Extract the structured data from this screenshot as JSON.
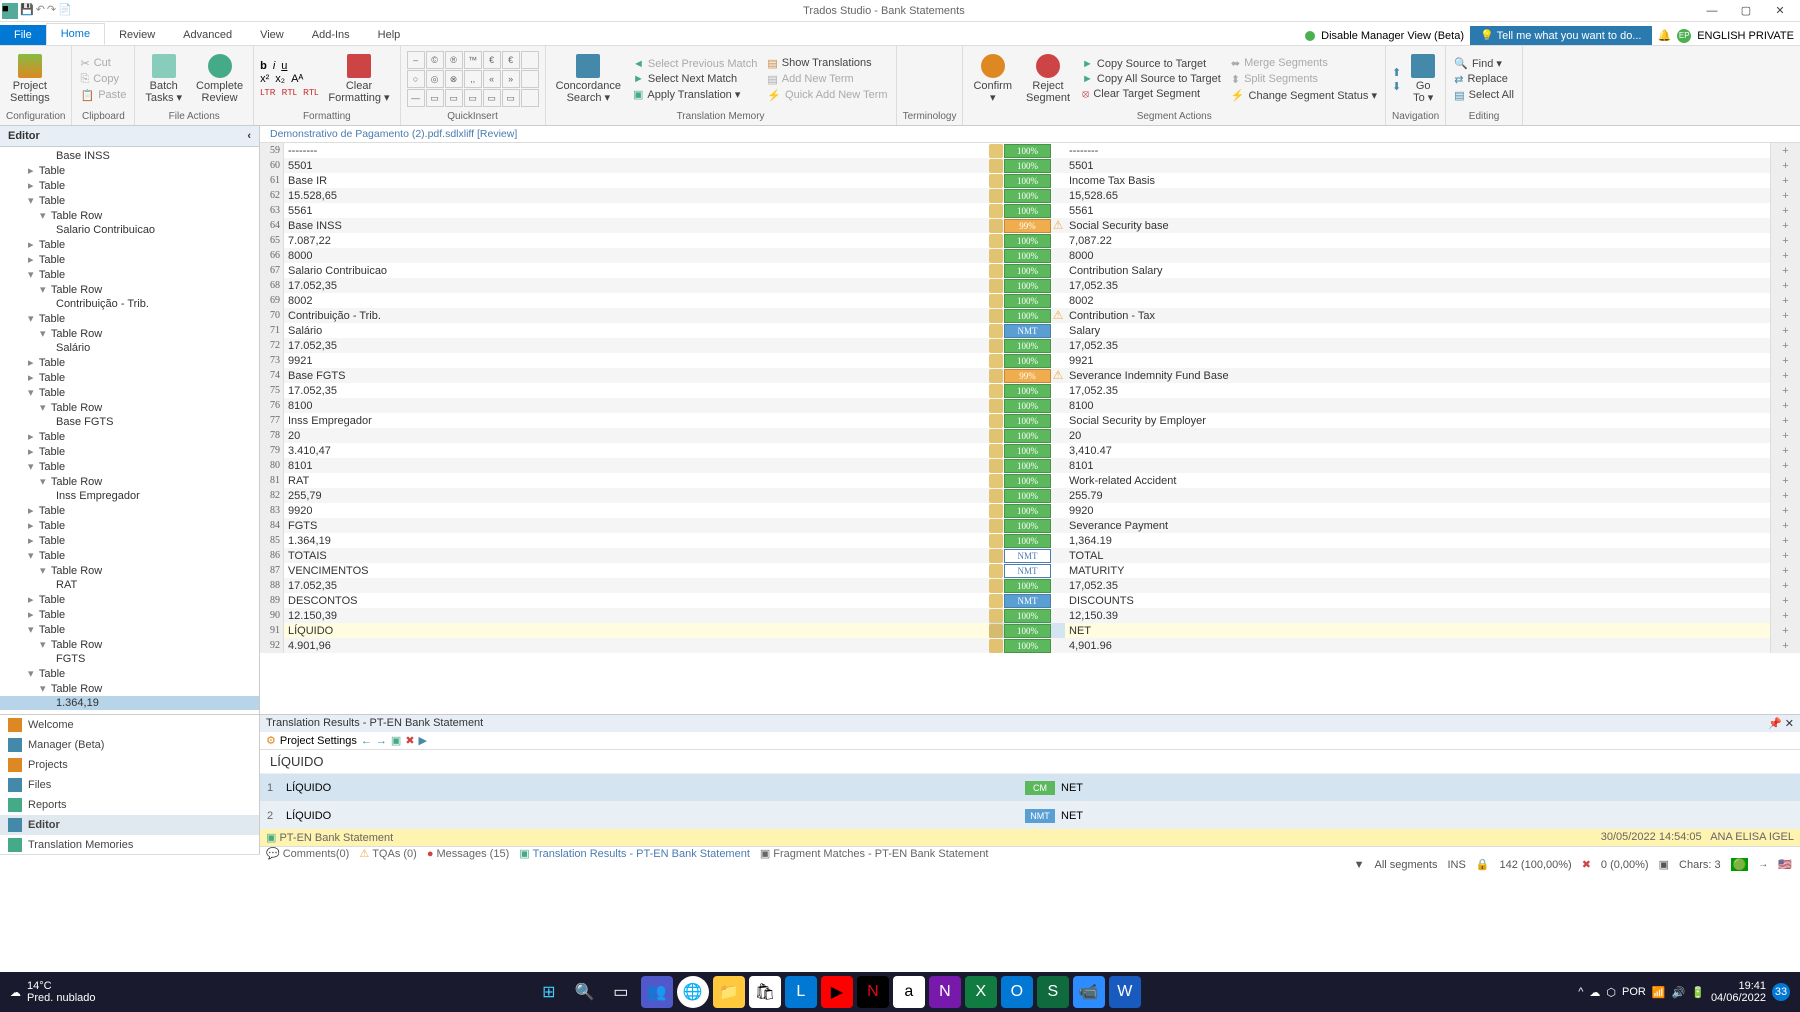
{
  "title": "Trados Studio - Bank Statements",
  "menu": {
    "file": "File",
    "home": "Home",
    "review": "Review",
    "advanced": "Advanced",
    "view": "View",
    "addins": "Add-Ins",
    "help": "Help",
    "disable_mgr": "Disable Manager View (Beta)",
    "tellme": "Tell me what you want to do...",
    "lang": "ENGLISH PRIVATE"
  },
  "ribbon": {
    "config": {
      "project_settings": "Project\nSettings",
      "label": "Configuration"
    },
    "clipboard": {
      "cut": "Cut",
      "copy": "Copy",
      "paste": "Paste",
      "label": "Clipboard"
    },
    "file_actions": {
      "batch": "Batch\nTasks ▾",
      "complete": "Complete\nReview",
      "label": "File Actions"
    },
    "formatting": {
      "clear": "Clear\nFormatting ▾",
      "label": "Formatting"
    },
    "quickinsert": {
      "label": "QuickInsert"
    },
    "tm": {
      "concordance": "Concordance\nSearch ▾",
      "prev": "Select Previous Match",
      "next": "Select Next Match",
      "apply": "Apply Translation ▾",
      "show": "Show Translations",
      "addnew": "Add New Term",
      "quickadd": "Quick Add New Term",
      "label": "Translation Memory"
    },
    "terminology": {
      "label": "Terminology"
    },
    "segment": {
      "confirm": "Confirm\n▾",
      "reject": "Reject\nSegment",
      "copysrc": "Copy Source to Target",
      "copyall": "Copy All Source to Target",
      "cleartgt": "Clear Target Segment",
      "merge": "Merge Segments",
      "split": "Split Segments",
      "change": "Change Segment Status ▾",
      "label": "Segment Actions"
    },
    "nav": {
      "goto": "Go\nTo ▾",
      "label": "Navigation"
    },
    "editing": {
      "find": "Find ▾",
      "replace": "Replace",
      "selectall": "Select All",
      "label": "Editing"
    }
  },
  "editor_header": "Editor",
  "doc_tab": "Demonstrativo de Pagamento (2).pdf.sdlxliff [Review]",
  "tree": [
    {
      "lvl": 3,
      "t": "Base INSS"
    },
    {
      "lvl": 1,
      "t": "Table",
      "a": "▸"
    },
    {
      "lvl": 1,
      "t": "Table",
      "a": "▸"
    },
    {
      "lvl": 1,
      "t": "Table",
      "a": "▾"
    },
    {
      "lvl": 2,
      "t": "Table Row",
      "a": "▾"
    },
    {
      "lvl": 3,
      "t": "Salario Contribuicao"
    },
    {
      "lvl": 1,
      "t": "Table",
      "a": "▸"
    },
    {
      "lvl": 1,
      "t": "Table",
      "a": "▸"
    },
    {
      "lvl": 1,
      "t": "Table",
      "a": "▾"
    },
    {
      "lvl": 2,
      "t": "Table Row",
      "a": "▾"
    },
    {
      "lvl": 3,
      "t": "Contribuição - Trib."
    },
    {
      "lvl": 1,
      "t": "Table",
      "a": "▾"
    },
    {
      "lvl": 2,
      "t": "Table Row",
      "a": "▾"
    },
    {
      "lvl": 3,
      "t": "Salário"
    },
    {
      "lvl": 1,
      "t": "Table",
      "a": "▸"
    },
    {
      "lvl": 1,
      "t": "Table",
      "a": "▸"
    },
    {
      "lvl": 1,
      "t": "Table",
      "a": "▾"
    },
    {
      "lvl": 2,
      "t": "Table Row",
      "a": "▾"
    },
    {
      "lvl": 3,
      "t": "Base FGTS"
    },
    {
      "lvl": 1,
      "t": "Table",
      "a": "▸"
    },
    {
      "lvl": 1,
      "t": "Table",
      "a": "▸"
    },
    {
      "lvl": 1,
      "t": "Table",
      "a": "▾"
    },
    {
      "lvl": 2,
      "t": "Table Row",
      "a": "▾"
    },
    {
      "lvl": 3,
      "t": "Inss Empregador"
    },
    {
      "lvl": 1,
      "t": "Table",
      "a": "▸"
    },
    {
      "lvl": 1,
      "t": "Table",
      "a": "▸"
    },
    {
      "lvl": 1,
      "t": "Table",
      "a": "▸"
    },
    {
      "lvl": 1,
      "t": "Table",
      "a": "▾"
    },
    {
      "lvl": 2,
      "t": "Table Row",
      "a": "▾"
    },
    {
      "lvl": 3,
      "t": "RAT"
    },
    {
      "lvl": 1,
      "t": "Table",
      "a": "▸"
    },
    {
      "lvl": 1,
      "t": "Table",
      "a": "▸"
    },
    {
      "lvl": 1,
      "t": "Table",
      "a": "▾"
    },
    {
      "lvl": 2,
      "t": "Table Row",
      "a": "▾"
    },
    {
      "lvl": 3,
      "t": "FGTS"
    },
    {
      "lvl": 1,
      "t": "Table",
      "a": "▾"
    },
    {
      "lvl": 2,
      "t": "Table Row",
      "a": "▾"
    },
    {
      "lvl": 3,
      "t": "1.364,19",
      "sel": true
    }
  ],
  "segments": [
    {
      "n": 59,
      "src": "--------",
      "badge": "100%",
      "cls": "badge-100",
      "tgt": "--------"
    },
    {
      "n": 60,
      "src": "5501",
      "badge": "100%",
      "cls": "badge-100",
      "tgt": "5501"
    },
    {
      "n": 61,
      "src": "Base IR",
      "badge": "100%",
      "cls": "badge-100",
      "tgt": "Income Tax Basis"
    },
    {
      "n": 62,
      "src": "15.528,65",
      "badge": "100%",
      "cls": "badge-100",
      "tgt": "15,528.65"
    },
    {
      "n": 63,
      "src": "5561",
      "badge": "100%",
      "cls": "badge-100",
      "tgt": "5561"
    },
    {
      "n": 64,
      "src": "Base INSS",
      "badge": "99%",
      "cls": "badge-99",
      "warn": true,
      "tgt": "Social Security base"
    },
    {
      "n": 65,
      "src": "7.087,22",
      "badge": "100%",
      "cls": "badge-100",
      "tgt": "7,087.22"
    },
    {
      "n": 66,
      "src": "8000",
      "badge": "100%",
      "cls": "badge-100",
      "tgt": "8000"
    },
    {
      "n": 67,
      "src": "Salario Contribuicao",
      "badge": "100%",
      "cls": "badge-100",
      "tgt": "Contribution Salary"
    },
    {
      "n": 68,
      "src": "17.052,35",
      "badge": "100%",
      "cls": "badge-100",
      "tgt": "17,052.35"
    },
    {
      "n": 69,
      "src": "8002",
      "badge": "100%",
      "cls": "badge-100",
      "tgt": "8002"
    },
    {
      "n": 70,
      "src": "Contribuição - Trib.",
      "badge": "100%",
      "cls": "badge-100",
      "warn": true,
      "tgt": "Contribution - Tax"
    },
    {
      "n": 71,
      "src": "Salário",
      "badge": "NMT",
      "cls": "badge-nmt-blue",
      "tgt": "Salary"
    },
    {
      "n": 72,
      "src": "17.052,35",
      "badge": "100%",
      "cls": "badge-100",
      "tgt": "17,052.35"
    },
    {
      "n": 73,
      "src": "9921",
      "badge": "100%",
      "cls": "badge-100",
      "tgt": "9921"
    },
    {
      "n": 74,
      "src": "Base FGTS",
      "badge": "99%",
      "cls": "badge-99",
      "warn": true,
      "tgt": "Severance Indemnity Fund Base"
    },
    {
      "n": 75,
      "src": "17.052,35",
      "badge": "100%",
      "cls": "badge-100",
      "tgt": "17,052.35"
    },
    {
      "n": 76,
      "src": "8100",
      "badge": "100%",
      "cls": "badge-100",
      "tgt": "8100"
    },
    {
      "n": 77,
      "src": "Inss Empregador",
      "badge": "100%",
      "cls": "badge-100",
      "tgt": "Social Security by Employer"
    },
    {
      "n": 78,
      "src": "20",
      "badge": "100%",
      "cls": "badge-100",
      "tgt": "20"
    },
    {
      "n": 79,
      "src": "3.410,47",
      "badge": "100%",
      "cls": "badge-100",
      "tgt": "3,410.47"
    },
    {
      "n": 80,
      "src": "8101",
      "badge": "100%",
      "cls": "badge-100",
      "tgt": "8101"
    },
    {
      "n": 81,
      "src": "RAT",
      "badge": "100%",
      "cls": "badge-100",
      "tgt": "Work-related Accident"
    },
    {
      "n": 82,
      "src": "255,79",
      "badge": "100%",
      "cls": "badge-100",
      "tgt": "255.79"
    },
    {
      "n": 83,
      "src": "9920",
      "badge": "100%",
      "cls": "badge-100",
      "tgt": "9920"
    },
    {
      "n": 84,
      "src": "FGTS",
      "badge": "100%",
      "cls": "badge-100",
      "tgt": "Severance Payment"
    },
    {
      "n": 85,
      "src": "1.364,19",
      "badge": "100%",
      "cls": "badge-100",
      "tgt": "1,364.19"
    },
    {
      "n": 86,
      "src": "TOTAIS",
      "badge": "NMT",
      "cls": "badge-nmt",
      "tgt": "TOTAL",
      "big": true
    },
    {
      "n": 87,
      "src": "VENCIMENTOS",
      "badge": "NMT",
      "cls": "badge-nmt",
      "tgt": "MATURITY"
    },
    {
      "n": 88,
      "src": "17.052,35",
      "badge": "100%",
      "cls": "badge-100",
      "tgt": "17,052.35"
    },
    {
      "n": 89,
      "src": "DESCONTOS",
      "badge": "NMT",
      "cls": "badge-nmt-blue",
      "tgt": "DISCOUNTS"
    },
    {
      "n": 90,
      "src": "12.150,39",
      "badge": "100%",
      "cls": "badge-100",
      "tgt": "12,150.39"
    },
    {
      "n": 91,
      "src": "LÍQUIDO",
      "badge": "100%",
      "cls": "badge-100",
      "tgt": "NET",
      "sel": true
    },
    {
      "n": 92,
      "src": "4.901,96",
      "badge": "100%",
      "cls": "badge-100",
      "tgt": "4,901.96"
    }
  ],
  "nav": {
    "welcome": "Welcome",
    "manager": "Manager (Beta)",
    "projects": "Projects",
    "files": "Files",
    "reports": "Reports",
    "editor": "Editor",
    "tm": "Translation Memories"
  },
  "tm_panel": {
    "header": "Translation Results - PT-EN Bank Statement",
    "project_settings": "Project Settings",
    "term": "LÍQUIDO",
    "results": [
      {
        "n": 1,
        "src": "LÍQUIDO",
        "badge": "CM",
        "bcls": "cm",
        "tgt": "NET"
      },
      {
        "n": 2,
        "src": "LÍQUIDO",
        "badge": "NMT",
        "bcls": "nmt",
        "tgt": "NET"
      }
    ],
    "status_name": "PT-EN Bank Statement",
    "status_date": "30/05/2022 14:54:05",
    "status_user": "ANA ELISA IGEL"
  },
  "bottom_tabs": {
    "comments": "Comments(0)",
    "tqas": "TQAs (0)",
    "messages": "Messages (15)",
    "tr": "Translation Results - PT-EN Bank Statement",
    "fm": "Fragment Matches - PT-EN Bank Statement"
  },
  "statusbar": {
    "filter": "All segments",
    "ins": "INS",
    "counts": "142 (100,00%)",
    "zero": "0 (0,00%)",
    "chars": "Chars: 3"
  },
  "taskbar": {
    "weather": "14°C\nPred. nublado",
    "lang": "POR",
    "time": "19:41",
    "date": "04/06/2022"
  }
}
